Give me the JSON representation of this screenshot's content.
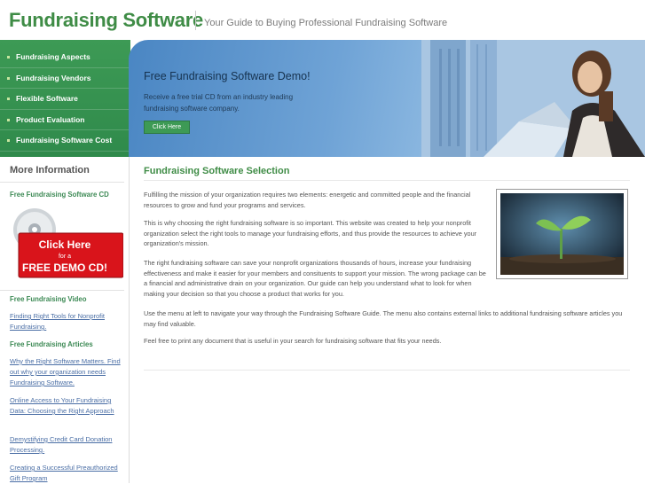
{
  "header": {
    "title": "Fundraising Software",
    "tagline": "Your Guide to Buying Professional Fundraising Software"
  },
  "nav": {
    "items": [
      {
        "label": "Fundraising Aspects"
      },
      {
        "label": "Fundraising Vendors"
      },
      {
        "label": "Flexible Software"
      },
      {
        "label": "Product Evaluation"
      },
      {
        "label": "Fundraising Software Cost"
      }
    ]
  },
  "hero": {
    "title": "Free Fundraising Software Demo!",
    "text": "Receive a free trial CD from an industry leading fundraising software company.",
    "button_label": "Click Here"
  },
  "sidebar": {
    "more_info": "More Information",
    "cd_heading": "Free Fundraising Software CD",
    "cd_promo": {
      "line1": "Click Here",
      "line2": "for a",
      "line3": "FREE DEMO CD!"
    },
    "video_heading": "Free Fundraising Video",
    "video_link": "Finding Right Tools for Nonprofit Fundraising.",
    "articles_heading": "Free Fundraising Articles",
    "articles": [
      "Why the Right Software Matters. Find out why your organization needs Fundraising Software.",
      "Online Access to Your Fundraising Data: Choosing the Right Approach",
      "Demystifying Credit Card Donation Processing.",
      "Creating a Successful Preauthorized Gift Program"
    ]
  },
  "main": {
    "title": "Fundraising Software Selection",
    "paragraphs": [
      "Fulfilling the mission of your organization requires two elements: energetic and committed people and the financial resources to grow and fund your programs and services.",
      "This is why choosing the right fundraising software is so important. This website was created to help your nonprofit organization select the right tools to manage your fundraising efforts, and thus provide the resources to achieve your organization's mission.",
      "The right fundraising software can save your nonprofit organizations thousands of hours, increase your fundraising effectiveness and make it easier for your members and consituents to support your mission. The wrong package can be a financial and administrative drain on your organization. Our guide can help you understand what to look for when making your decision so that you choose a product that works for you.",
      "Use the menu at left to navigate your way through the Fundraising Software Guide. The menu also contains external links to additional fundraising software articles you may find valuable.",
      "Feel free to print any document that is useful in your search for fundraising software that fits your needs."
    ]
  },
  "colors": {
    "brand_green": "#3f8c46",
    "nav_green": "#3d9a55",
    "hero_blue": "#6fa3d6",
    "link_blue": "#4a6ea5",
    "promo_red": "#d9141b"
  }
}
